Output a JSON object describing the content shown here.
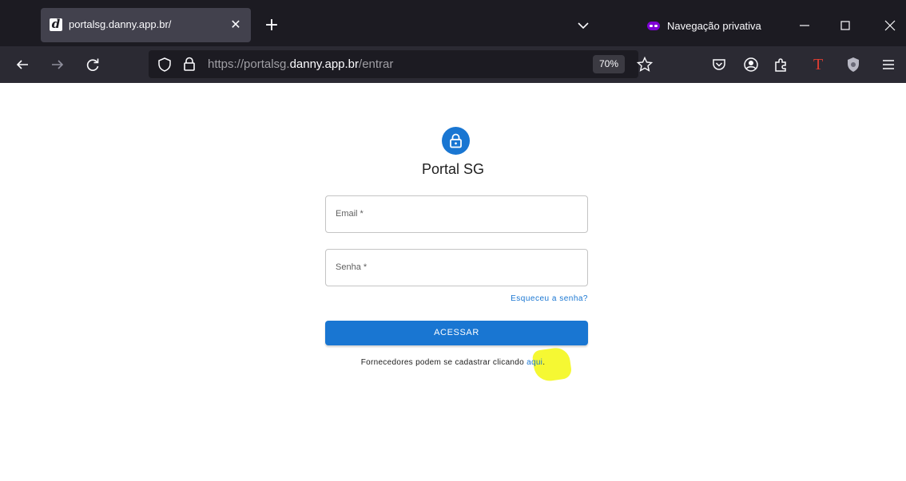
{
  "browser": {
    "tab": {
      "title": "portalsg.danny.app.br/",
      "favicon_letter": "d",
      "close_glyph": "✕"
    },
    "new_tab_glyph": "+",
    "private_label": "Navegação privativa",
    "url": {
      "scheme_prefix": "https://portalsg.",
      "host": "danny.app.br",
      "path": "/entrar"
    },
    "zoom": "70%",
    "icons": [
      "back-icon",
      "forward-icon",
      "reload-icon",
      "shield-icon",
      "lock-icon",
      "star-icon",
      "pocket-icon",
      "account-icon",
      "extensions-icon",
      "translate-icon",
      "ublock-icon",
      "menu-icon"
    ]
  },
  "page": {
    "title": "Portal SG",
    "email_label": "Email *",
    "password_label": "Senha *",
    "forgot_link": "Esqueceu a senha?",
    "access_button": "ACESSAR",
    "signup_prefix": "Fornecedores podem se cadastrar clicando ",
    "signup_link": "aqui",
    "signup_suffix": ".",
    "colors": {
      "primary": "#1976d2",
      "highlight": "#f3f600"
    }
  }
}
